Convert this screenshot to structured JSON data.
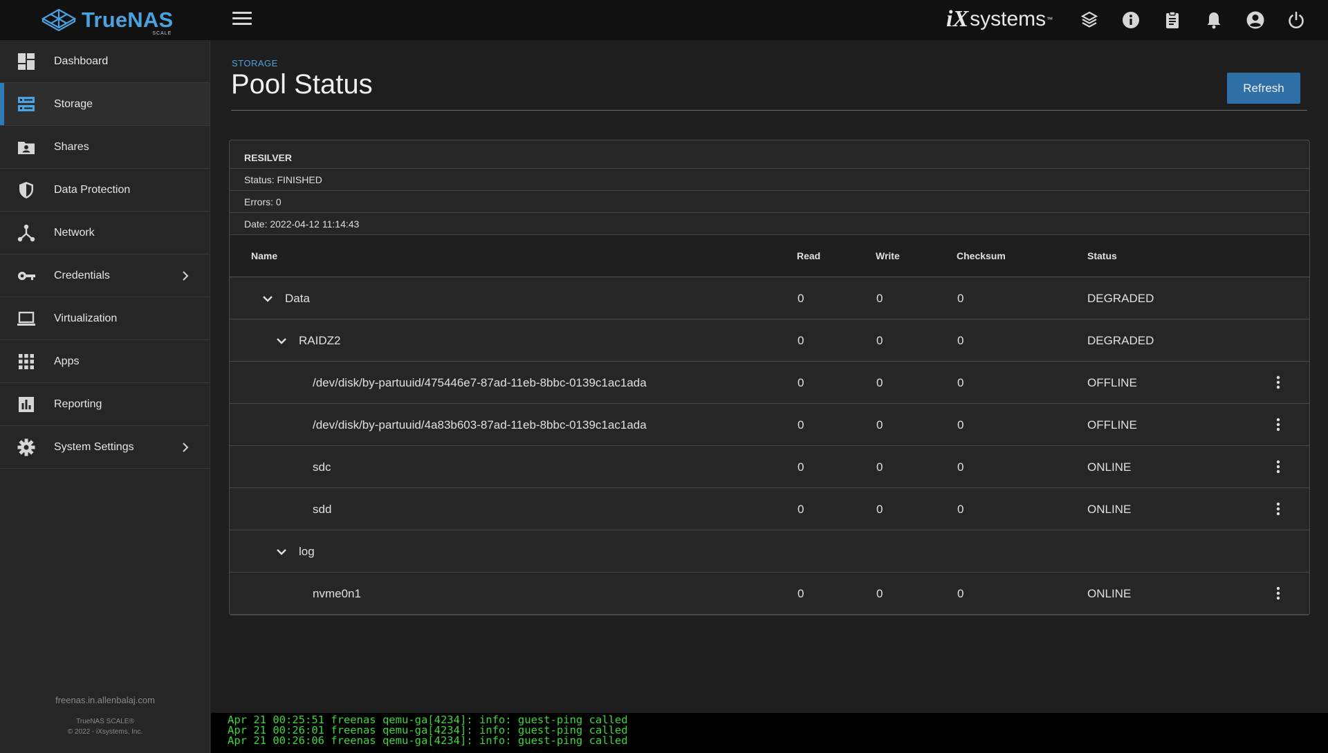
{
  "app": {
    "name": "TrueNAS",
    "edition": "SCALE",
    "vendor": {
      "ix": "iX",
      "systems": "systems",
      "tm": "™"
    }
  },
  "topbar": {
    "icons": [
      "menu-icon",
      "truecommand-icon",
      "info-icon",
      "clipboard-icon",
      "bell-icon",
      "account-icon",
      "power-icon"
    ]
  },
  "sidebar": {
    "items": [
      {
        "label": "Dashboard",
        "icon": "dashboard-icon",
        "active": false,
        "has_chevron": false
      },
      {
        "label": "Storage",
        "icon": "storage-icon",
        "active": true,
        "has_chevron": false
      },
      {
        "label": "Shares",
        "icon": "shares-icon",
        "active": false,
        "has_chevron": false
      },
      {
        "label": "Data Protection",
        "icon": "shield-icon",
        "active": false,
        "has_chevron": false
      },
      {
        "label": "Network",
        "icon": "network-icon",
        "active": false,
        "has_chevron": false
      },
      {
        "label": "Credentials",
        "icon": "key-icon",
        "active": false,
        "has_chevron": true
      },
      {
        "label": "Virtualization",
        "icon": "laptop-icon",
        "active": false,
        "has_chevron": false
      },
      {
        "label": "Apps",
        "icon": "apps-grid-icon",
        "active": false,
        "has_chevron": false
      },
      {
        "label": "Reporting",
        "icon": "bar-chart-icon",
        "active": false,
        "has_chevron": false
      },
      {
        "label": "System Settings",
        "icon": "gear-icon",
        "active": false,
        "has_chevron": true
      }
    ],
    "footer": {
      "hostname": "freenas.in.allenbalaj.com",
      "version": "TrueNAS SCALE®",
      "copyright": "© 2022 - iXsystems, Inc."
    }
  },
  "page": {
    "breadcrumb": "STORAGE",
    "title": "Pool Status",
    "refresh_label": "Refresh"
  },
  "resilver": {
    "title": "RESILVER",
    "status": "Status: FINISHED",
    "errors": "Errors: 0",
    "date": "Date: 2022-04-12 11:14:43"
  },
  "table": {
    "columns": {
      "name": "Name",
      "read": "Read",
      "write": "Write",
      "checksum": "Checksum",
      "status": "Status"
    },
    "rows": [
      {
        "name": "Data",
        "level": 0,
        "expandable": true,
        "read": "0",
        "write": "0",
        "checksum": "0",
        "status": "DEGRADED",
        "actions": false
      },
      {
        "name": "RAIDZ2",
        "level": 1,
        "expandable": true,
        "read": "0",
        "write": "0",
        "checksum": "0",
        "status": "DEGRADED",
        "actions": false
      },
      {
        "name": "/dev/disk/by-partuuid/475446e7-87ad-11eb-8bbc-0139c1ac1ada",
        "level": 2,
        "expandable": false,
        "read": "0",
        "write": "0",
        "checksum": "0",
        "status": "OFFLINE",
        "actions": true
      },
      {
        "name": "/dev/disk/by-partuuid/4a83b603-87ad-11eb-8bbc-0139c1ac1ada",
        "level": 2,
        "expandable": false,
        "read": "0",
        "write": "0",
        "checksum": "0",
        "status": "OFFLINE",
        "actions": true
      },
      {
        "name": "sdc",
        "level": 2,
        "expandable": false,
        "read": "0",
        "write": "0",
        "checksum": "0",
        "status": "ONLINE",
        "actions": true
      },
      {
        "name": "sdd",
        "level": 2,
        "expandable": false,
        "read": "0",
        "write": "0",
        "checksum": "0",
        "status": "ONLINE",
        "actions": true
      },
      {
        "name": "log",
        "level": 1,
        "expandable": true,
        "read": "",
        "write": "",
        "checksum": "",
        "status": "",
        "actions": false
      },
      {
        "name": "nvme0n1",
        "level": 2,
        "expandable": false,
        "read": "0",
        "write": "0",
        "checksum": "0",
        "status": "ONLINE",
        "actions": true
      }
    ]
  },
  "console": {
    "lines": [
      "Apr 21 00:25:51 freenas qemu-ga[4234]: info: guest-ping called",
      "Apr 21 00:26:01 freenas qemu-ga[4234]: info: guest-ping called",
      "Apr 21 00:26:06 freenas qemu-ga[4234]: info: guest-ping called"
    ]
  }
}
